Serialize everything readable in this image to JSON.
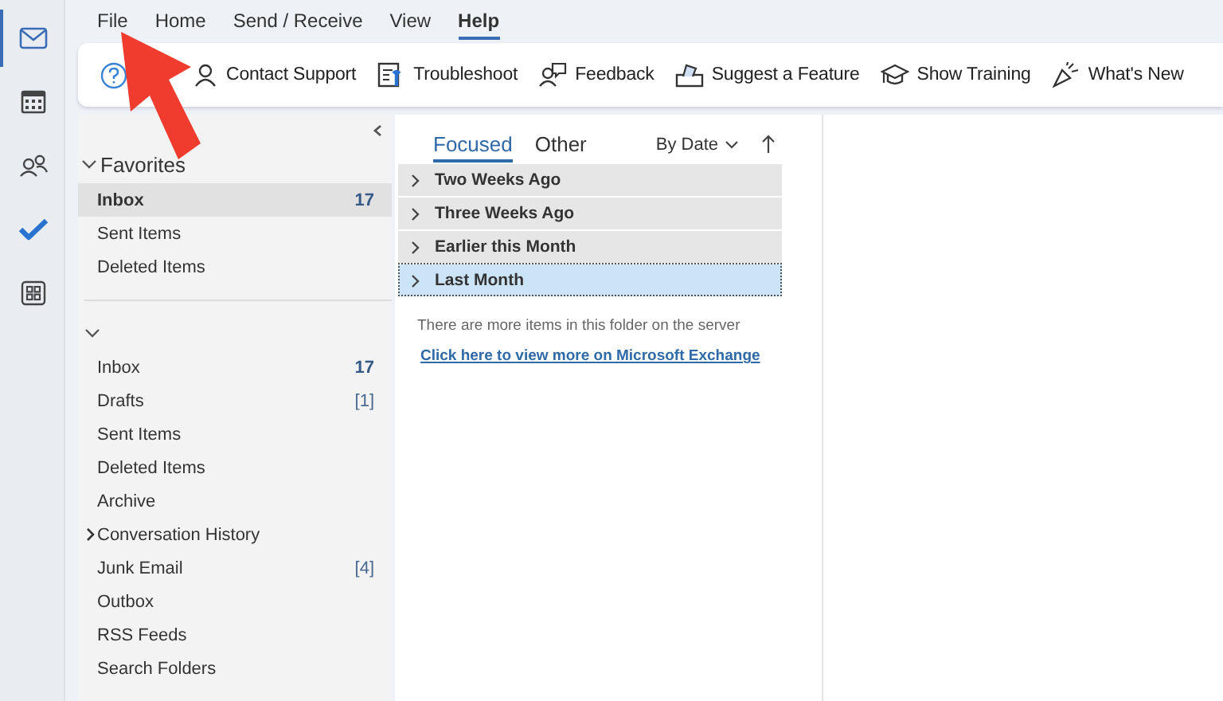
{
  "rail": [
    {
      "kind": "mail",
      "selected": true
    },
    {
      "kind": "calendar",
      "selected": false
    },
    {
      "kind": "people",
      "selected": false
    },
    {
      "kind": "todo",
      "selected": false
    },
    {
      "kind": "apps",
      "selected": false
    }
  ],
  "menu": [
    {
      "label": "File",
      "selected": false
    },
    {
      "label": "Home",
      "selected": false
    },
    {
      "label": "Send / Receive",
      "selected": false
    },
    {
      "label": "View",
      "selected": false
    },
    {
      "label": "Help",
      "selected": true
    }
  ],
  "ribbon": [
    {
      "kind": "help"
    },
    {
      "kind": "contact",
      "label": "Contact Support"
    },
    {
      "kind": "troubleshoot",
      "label": "Troubleshoot"
    },
    {
      "kind": "feedback",
      "label": "Feedback"
    },
    {
      "kind": "suggest",
      "label": "Suggest a Feature"
    },
    {
      "kind": "training",
      "label": "Show Training"
    },
    {
      "kind": "whatsnew",
      "label": "What's New"
    }
  ],
  "favorites": {
    "title": "Favorites",
    "expanded": true,
    "items": [
      {
        "name": "Inbox",
        "count": "17",
        "unread": true,
        "selected": true
      },
      {
        "name": "Sent Items",
        "selected": false
      },
      {
        "name": "Deleted Items",
        "selected": false
      }
    ]
  },
  "account": {
    "expanded": true,
    "folders": [
      {
        "name": "Inbox",
        "count": "17",
        "unread": true,
        "selected": false,
        "expandable": false
      },
      {
        "name": "Drafts",
        "count": "[1]",
        "unread": false,
        "selected": false,
        "expandable": false
      },
      {
        "name": "Sent Items",
        "selected": false,
        "expandable": false
      },
      {
        "name": "Deleted Items",
        "selected": false,
        "expandable": false
      },
      {
        "name": "Archive",
        "selected": false,
        "expandable": false
      },
      {
        "name": "Conversation History",
        "selected": false,
        "expandable": true
      },
      {
        "name": "Junk Email",
        "count": "[4]",
        "unread": false,
        "selected": false,
        "expandable": false
      },
      {
        "name": "Outbox",
        "selected": false,
        "expandable": false
      },
      {
        "name": "RSS Feeds",
        "selected": false,
        "expandable": false
      },
      {
        "name": "Search Folders",
        "selected": false,
        "expandable": false
      }
    ]
  },
  "message_list": {
    "tabs": [
      {
        "label": "Focused",
        "selected": true
      },
      {
        "label": "Other",
        "selected": false
      }
    ],
    "sort": "By Date",
    "groups": [
      {
        "label": "Two Weeks Ago",
        "selected": false
      },
      {
        "label": "Three Weeks Ago",
        "selected": false
      },
      {
        "label": "Earlier this Month",
        "selected": false
      },
      {
        "label": "Last Month",
        "selected": true
      }
    ],
    "info": "There are more items in this folder on the server",
    "link": "Click here to view more on Microsoft Exchange"
  },
  "annotation": {
    "kind": "arrow"
  }
}
